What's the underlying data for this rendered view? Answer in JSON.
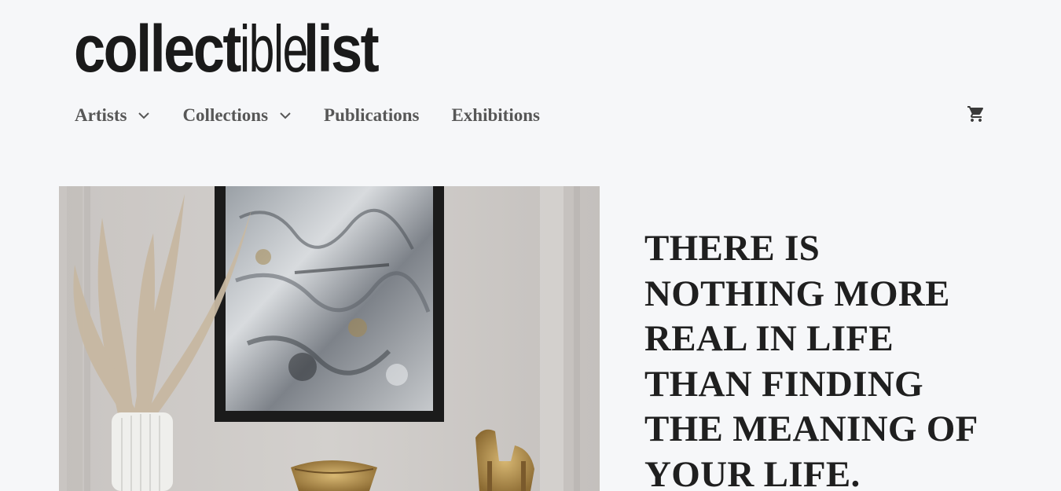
{
  "site": {
    "logo": {
      "part1": "collect",
      "part2": "ible",
      "part3": "list"
    }
  },
  "nav": {
    "items": [
      {
        "label": "Artists",
        "has_dropdown": true,
        "icon": "chevron-down-icon"
      },
      {
        "label": "Collections",
        "has_dropdown": true,
        "icon": "chevron-down-icon"
      },
      {
        "label": "Publications",
        "has_dropdown": false
      },
      {
        "label": "Exhibitions",
        "has_dropdown": false
      }
    ],
    "cart_icon": "shopping-cart-icon"
  },
  "hero": {
    "quote": "THERE IS NOTHING MORE REAL IN LIFE THAN FINDING THE MEANING OF YOUR LIFE."
  },
  "colors": {
    "background": "#f6f7f9",
    "nav_text": "#575757",
    "heading_text": "#1f1f1f",
    "logo": "#1a1a1a"
  }
}
